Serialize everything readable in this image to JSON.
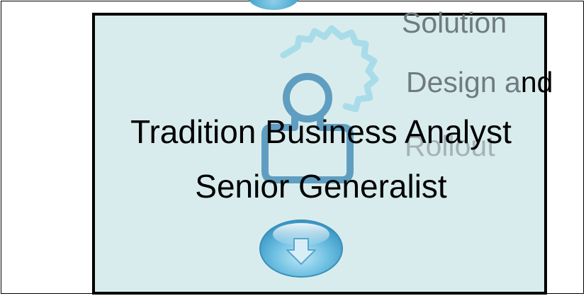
{
  "background_labels": {
    "solution": "Solution",
    "design_head": "Design a",
    "design_tail": "nd",
    "rollout": "Rollout"
  },
  "title": {
    "line1": "Tradition Business Analyst",
    "line2": "Senior Generalist"
  },
  "icons": {
    "gear": "gear-icon",
    "person": "person-icon",
    "down": "arrow-down-icon"
  },
  "colors": {
    "panel": "#d9eced",
    "gear": "#a9dce9",
    "person": "#5f9ec0",
    "orb": "#4aa8d0"
  }
}
